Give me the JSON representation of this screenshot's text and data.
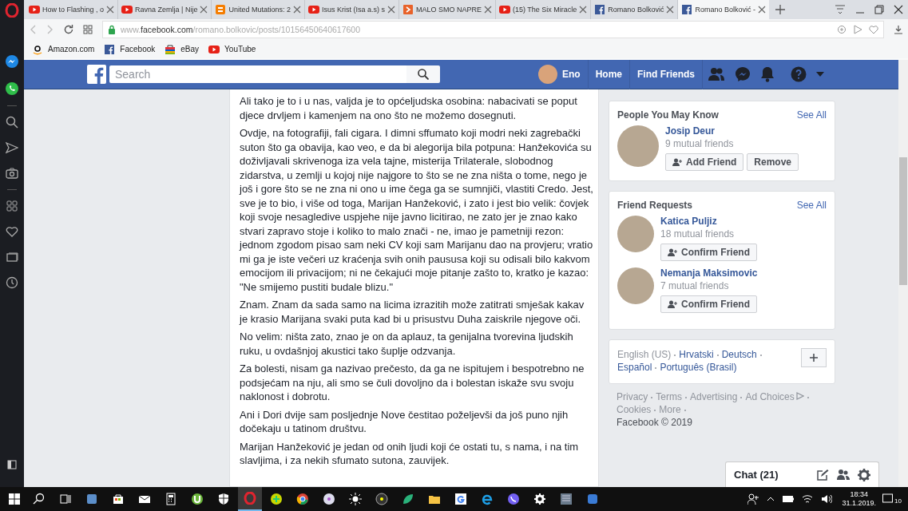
{
  "browser": {
    "tabs": [
      {
        "kind": "youtube",
        "title": "How to Flashing , o",
        "selected": false
      },
      {
        "kind": "youtube",
        "title": "Ravna Zemlja | Nije",
        "selected": false
      },
      {
        "kind": "blogger",
        "title": "United Mutations: 2",
        "selected": false
      },
      {
        "kind": "youtube",
        "title": "Isus Krist (Isa a.s) s",
        "selected": false
      },
      {
        "kind": "play",
        "title": "MALO SMO NAPRE",
        "selected": false
      },
      {
        "kind": "youtube",
        "title": "(15) The Six Miracle",
        "selected": false
      },
      {
        "kind": "facebook",
        "title": "Romano Bolković",
        "selected": false
      },
      {
        "kind": "facebook",
        "title": "Romano Bolković -",
        "selected": true
      }
    ],
    "url": "www.**facebook.com**/romano.bolkovic/posts/10156450640617600",
    "bookmarks": [
      {
        "kind": "amazon",
        "label": "Amazon.com"
      },
      {
        "kind": "facebook",
        "label": "Facebook"
      },
      {
        "kind": "ebay",
        "label": "eBay"
      },
      {
        "kind": "youtube",
        "label": "YouTube"
      }
    ]
  },
  "header": {
    "search": {
      "placeholder": "Search"
    },
    "user": "Eno",
    "nav": [
      "Home",
      "Find Friends"
    ]
  },
  "post": {
    "paragraphs": [
      "Ali tako je to i u nas, valjda je to općeljudska osobina: nabacivati se poput djece drvljem i kamenjem na ono što ne možemo dosegnuti.",
      "Ovdje, na fotografiji, fali cigara. I dimni sffumato koji modri neki zagrebački suton što ga obavija, kao veo, e da bi alegorija bila potpuna: Hanžekovića su doživljavali skrivenoga iza vela tajne, misterija Trilaterale, slobodnog zidarstva, u zemlji u kojoj nije najgore to što se ne zna ništa o tome, nego je još i gore što se ne zna ni ono u ime čega ga se sumnjiči, vlastiti Credo. Jest, sve je to bio, i više od toga, Marijan Hanžeković, i zato i jest bio velik: čovjek koji svoje nesagledive uspjehe nije javno licitirao, ne zato jer je znao kako stvari zapravo stoje i koliko to malo znači - ne, imao je pametniji rezon: jednom zgodom pisao sam neki CV koji sam Marijanu dao na provjeru; vratio mi ga je iste večeri uz kraćenja svih onih paususa koji su odisali bilo kakvom emocijom ili privacijom; ni ne čekajući moje pitanje zašto to, kratko je kazao: \"Ne smijemo pustiti budale blizu.\"",
      "Znam. Znam da sada samo na licima izrazitih može zatitrati smješak kakav je krasio Marijana svaki puta kad bi u prisustvu Duha zaiskrile njegove oči.",
      "No velim: ništa zato, znao je on da aplauz, ta genijalna tvorevina ljudskih ruku, u ovdašnjoj akustici tako šuplje odzvanja.",
      "Za bolesti, nisam ga nazivao prečesto, da ga ne ispitujem i bespotrebno ne podsjećam na nju, ali smo se čuli dovoljno da i bolestan iskaže svu svoju naklonost i dobrotu.",
      "Ani i Dori dvije sam posljednje Nove čestitao poželjevši da još puno njih dočekaju u tatinom društvu.",
      "Marijan Hanžeković je jedan od onih ljudi koji će ostati tu, s nama, i na tim slavljima, i za nekih sfumato sutona, zauvijek."
    ]
  },
  "people_you_may_know": {
    "title": "People You May Know",
    "see_all": "See All",
    "people": [
      {
        "name": "Josip Deur",
        "mutual": "9 mutual friends",
        "buttons": [
          {
            "kind": "add",
            "label": "Add Friend"
          },
          {
            "kind": "plain",
            "label": "Remove"
          }
        ]
      }
    ]
  },
  "friend_requests": {
    "title": "Friend Requests",
    "see_all": "See All",
    "people": [
      {
        "name": "Katica Puljiz",
        "mutual": "18 mutual friends",
        "buttons": [
          {
            "kind": "add",
            "label": "Confirm Friend"
          }
        ]
      },
      {
        "name": "Nemanja Maksimovic",
        "mutual": "7 mutual friends",
        "buttons": [
          {
            "kind": "add",
            "label": "Confirm Friend"
          }
        ]
      }
    ]
  },
  "languages": [
    {
      "label": "English (US)",
      "selected": true
    },
    {
      "label": "Hrvatski",
      "selected": false
    },
    {
      "label": "Deutsch",
      "selected": false
    },
    {
      "label": "Español",
      "selected": false
    },
    {
      "label": "Português (Brasil)",
      "selected": false
    }
  ],
  "footer_links": [
    "Privacy",
    "Terms",
    "Advertising",
    "Ad Choices",
    "Cookies",
    "More"
  ],
  "copyright": "Facebook © 2019",
  "chat": {
    "label": "Chat (21)"
  },
  "taskbar": {
    "apps": [
      {
        "selected": false
      },
      {
        "selected": false
      },
      {
        "selected": false
      },
      {
        "selected": false
      },
      {
        "selected": false
      },
      {
        "selected": false
      },
      {
        "selected": false
      },
      {
        "selected": false
      },
      {
        "selected": true
      },
      {
        "selected": false
      },
      {
        "selected": false
      },
      {
        "selected": false
      },
      {
        "selected": false
      },
      {
        "selected": false
      },
      {
        "selected": false
      },
      {
        "selected": false
      },
      {
        "selected": false
      },
      {
        "selected": false
      },
      {
        "selected": false
      },
      {
        "selected": false
      },
      {
        "selected": false
      },
      {
        "selected": false
      }
    ],
    "time": "18:34",
    "date": "31.1.2019.",
    "notifications": "10"
  }
}
